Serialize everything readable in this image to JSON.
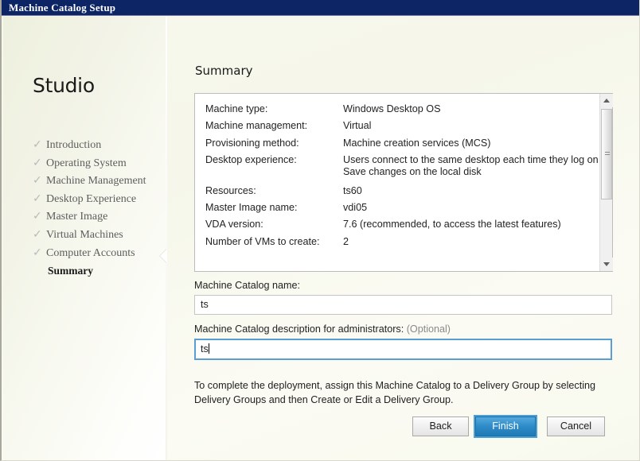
{
  "window": {
    "title": "Machine Catalog Setup"
  },
  "sidebar": {
    "product_title": "Studio",
    "steps": [
      {
        "label": "Introduction",
        "state": "done",
        "icon": "check-icon"
      },
      {
        "label": "Operating System",
        "state": "done",
        "icon": "check-icon"
      },
      {
        "label": "Machine Management",
        "state": "done",
        "icon": "check-icon"
      },
      {
        "label": "Desktop Experience",
        "state": "done",
        "icon": "check-icon"
      },
      {
        "label": "Master Image",
        "state": "done",
        "icon": "check-icon"
      },
      {
        "label": "Virtual Machines",
        "state": "done",
        "icon": "check-icon"
      },
      {
        "label": "Computer Accounts",
        "state": "done",
        "icon": "check-icon"
      },
      {
        "label": "Summary",
        "state": "current",
        "icon": ""
      }
    ]
  },
  "main": {
    "page_title": "Summary",
    "summary_rows": [
      {
        "label": "Machine type:",
        "value": "Windows Desktop OS"
      },
      {
        "label": "Machine management:",
        "value": "Virtual"
      },
      {
        "label": "Provisioning method:",
        "value": "Machine creation services (MCS)"
      },
      {
        "label": "Desktop experience:",
        "value": "Users connect to the same desktop each time they log on\nSave changes on the local disk"
      },
      {
        "label": "Resources:",
        "value": "ts60"
      },
      {
        "label": "Master Image name:",
        "value": "vdi05"
      },
      {
        "label": "VDA version:",
        "value": "7.6 (recommended, to access the latest features)"
      },
      {
        "label": "Number of VMs to create:",
        "value": "2"
      }
    ],
    "catalog_name": {
      "label": "Machine Catalog name:",
      "value": "ts",
      "placeholder": ""
    },
    "catalog_description": {
      "label": "Machine Catalog description for administrators:",
      "optional_tag": "(Optional)",
      "value": "ts",
      "placeholder": ""
    },
    "hint": "To complete the deployment, assign this Machine Catalog to a Delivery Group by selecting Delivery Groups and then Create or Edit a Delivery Group."
  },
  "footer": {
    "back_label": "Back",
    "finish_label": "Finish",
    "cancel_label": "Cancel"
  },
  "colors": {
    "titlebar": "#0d2465",
    "primary_button": "#2f8cc8",
    "focus_border": "#5a9fd4",
    "background": "#f7f8ec"
  }
}
